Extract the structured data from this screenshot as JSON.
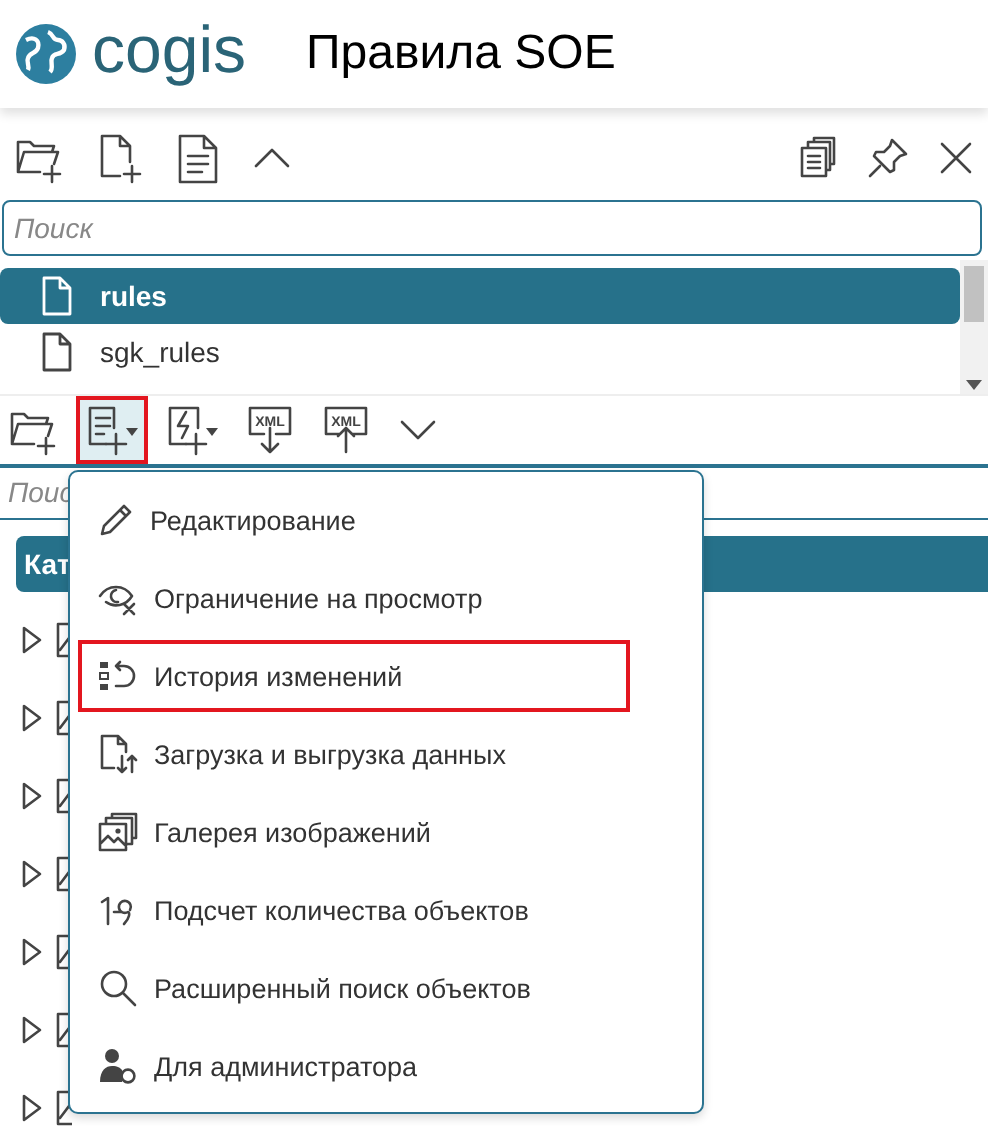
{
  "header": {
    "logo_text": "cogis",
    "title": "Правила SOE"
  },
  "panel": {
    "search": {
      "placeholder": "Поиск"
    },
    "files": [
      {
        "name": "rules",
        "selected": true
      },
      {
        "name": "sgk_rules",
        "selected": false
      }
    ]
  },
  "toolbar": [
    {
      "kind": "folder-add",
      "highlighted": false
    },
    {
      "kind": "doc-add-menu",
      "highlighted": true
    },
    {
      "kind": "bolt-add-menu",
      "highlighted": false
    },
    {
      "kind": "xml-import",
      "label": "XML",
      "highlighted": false
    },
    {
      "kind": "xml-export",
      "label": "XML",
      "highlighted": false
    },
    {
      "kind": "chevron-down",
      "highlighted": false
    }
  ],
  "objects": {
    "search": {
      "placeholder": "Поис"
    },
    "tree_header": "Кат",
    "tree_rows": [
      {
        "expanded": false
      },
      {
        "expanded": false
      },
      {
        "expanded": false
      },
      {
        "expanded": false
      },
      {
        "expanded": false
      },
      {
        "expanded": false
      },
      {
        "expanded": false
      }
    ]
  },
  "menu": {
    "items": [
      {
        "kind": "edit",
        "label": "Редактирование",
        "highlighted": false
      },
      {
        "kind": "view-limit",
        "label": "Ограничение на просмотр",
        "highlighted": false
      },
      {
        "kind": "history",
        "label": "История изменений",
        "highlighted": true
      },
      {
        "kind": "load",
        "label": "Загрузка и выгрузка данных",
        "highlighted": false
      },
      {
        "kind": "gallery",
        "label": "Галерея изображений",
        "highlighted": false
      },
      {
        "kind": "count",
        "label": "Подсчет количества объектов",
        "highlighted": false
      },
      {
        "kind": "search",
        "label": "Расширенный поиск объектов",
        "highlighted": false
      },
      {
        "kind": "admin",
        "label": "Для администратора",
        "highlighted": false
      }
    ]
  }
}
